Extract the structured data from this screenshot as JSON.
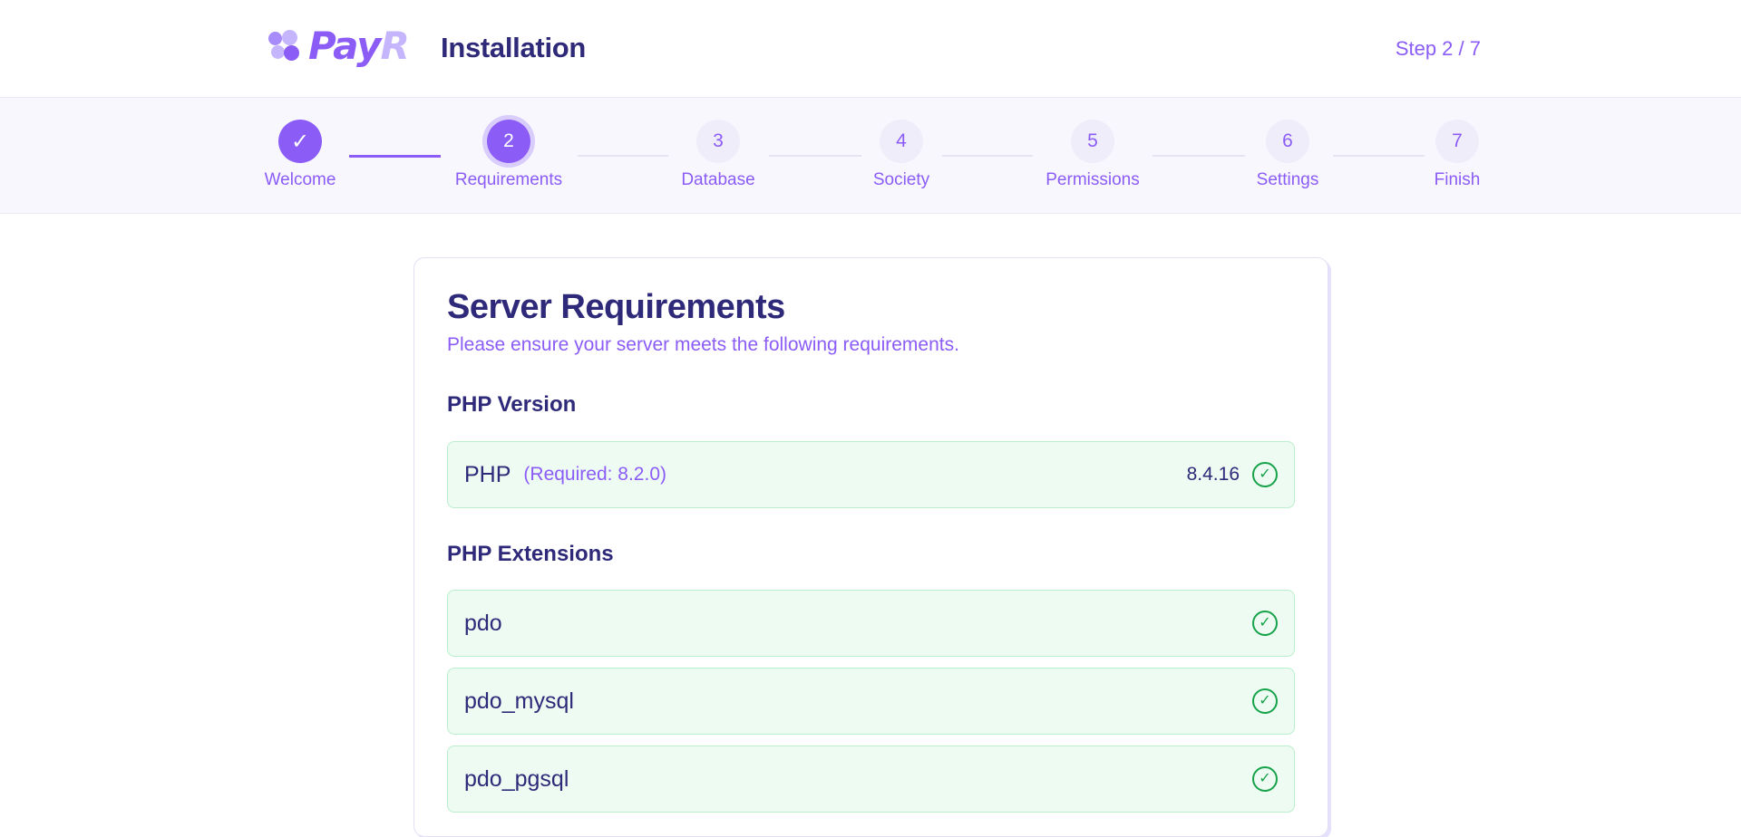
{
  "header": {
    "logo_part1": "Pay",
    "logo_part2": "R",
    "title": "Installation",
    "step_count": "Step 2 / 7"
  },
  "stepper": {
    "steps": [
      {
        "number": "✓",
        "label": "Welcome",
        "state": "done"
      },
      {
        "number": "2",
        "label": "Requirements",
        "state": "active"
      },
      {
        "number": "3",
        "label": "Database",
        "state": "pending"
      },
      {
        "number": "4",
        "label": "Society",
        "state": "pending"
      },
      {
        "number": "5",
        "label": "Permissions",
        "state": "pending"
      },
      {
        "number": "6",
        "label": "Settings",
        "state": "pending"
      },
      {
        "number": "7",
        "label": "Finish",
        "state": "pending"
      }
    ]
  },
  "card": {
    "title": "Server Requirements",
    "subtitle": "Please ensure your server meets the following requirements.",
    "php_section": "PHP Version",
    "php": {
      "name": "PHP",
      "note": "(Required: 8.2.0)",
      "value": "8.4.16",
      "status": "ok"
    },
    "extensions_section": "PHP Extensions",
    "extensions": [
      {
        "name": "pdo",
        "status": "ok"
      },
      {
        "name": "pdo_mysql",
        "status": "ok"
      },
      {
        "name": "pdo_pgsql",
        "status": "ok"
      }
    ]
  },
  "colors": {
    "accent": "#8b5cf6",
    "heading": "#2e2a79",
    "success": "#16a34a",
    "success_bg": "#edfbf2"
  },
  "icons": {
    "check": "check-circle-icon",
    "done_step": "checkmark-icon"
  }
}
